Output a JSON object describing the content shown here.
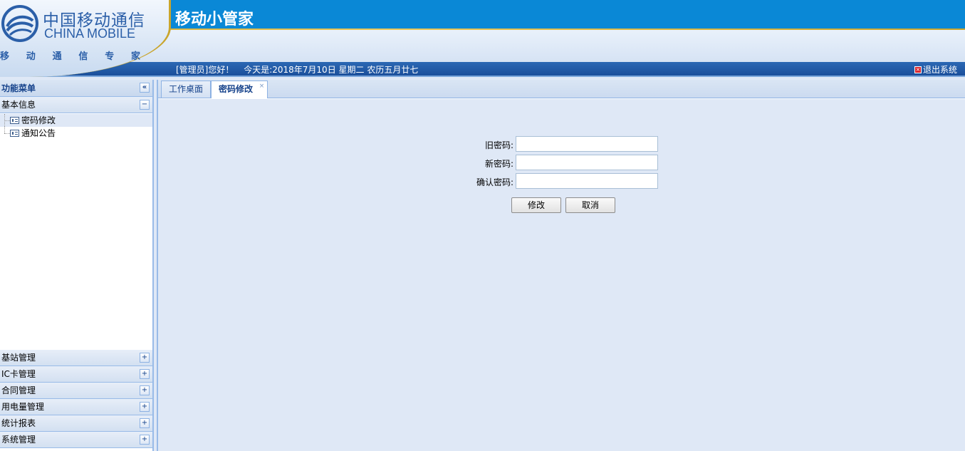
{
  "header": {
    "brand_cn": "中国移动通信",
    "brand_en": "CHINA MOBILE",
    "brand_tag": [
      "移",
      "动",
      "通",
      "信",
      "专",
      "家"
    ],
    "app_title": "移动小管家",
    "welcome_user": "[管理员]您好！",
    "welcome_date": "今天是:2018年7月10日 星期二 农历五月廿七",
    "logout_label": "退出系统"
  },
  "sidebar": {
    "title": "功能菜单",
    "collapse_symbol": "«",
    "open_section": {
      "label": "基本信息",
      "toggle": "−",
      "items": [
        {
          "label": "密码修改",
          "selected": true
        },
        {
          "label": "通知公告",
          "selected": false
        }
      ]
    },
    "sections": [
      {
        "label": "基站管理",
        "toggle": "+"
      },
      {
        "label": "IC卡管理",
        "toggle": "+"
      },
      {
        "label": "合同管理",
        "toggle": "+"
      },
      {
        "label": "用电量管理",
        "toggle": "+"
      },
      {
        "label": "统计报表",
        "toggle": "+"
      },
      {
        "label": "系统管理",
        "toggle": "+"
      }
    ]
  },
  "tabs": [
    {
      "label": "工作桌面",
      "active": false
    },
    {
      "label": "密码修改",
      "active": true,
      "close_symbol": "×"
    }
  ],
  "form": {
    "old_password_label": "旧密码:",
    "new_password_label": "新密码:",
    "confirm_password_label": "确认密码:",
    "old_password_value": "",
    "new_password_value": "",
    "confirm_password_value": "",
    "submit_label": "修改",
    "cancel_label": "取消"
  },
  "colors": {
    "header_blue": "#0a88d6",
    "status_bar": "#1b4f9b",
    "panel_border": "#99bbe8",
    "content_bg": "#dfe8f6",
    "gold_accent": "#c9a52c"
  }
}
